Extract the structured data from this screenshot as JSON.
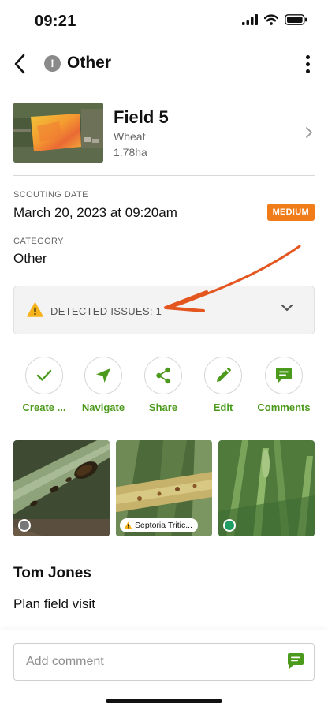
{
  "status_bar": {
    "time": "09:21"
  },
  "header": {
    "badge": "!",
    "title": "Other"
  },
  "field": {
    "name": "Field 5",
    "crop": "Wheat",
    "area": "1.78ha"
  },
  "scouting": {
    "date_label": "SCOUTING DATE",
    "date_value": "March 20, 2023 at 09:20am",
    "severity": "MEDIUM"
  },
  "category": {
    "label": "CATEGORY",
    "value": "Other"
  },
  "issues": {
    "label": "DETECTED ISSUES: 1"
  },
  "actions": [
    {
      "label": "Create ...",
      "icon": "check-icon"
    },
    {
      "label": "Navigate",
      "icon": "navigate-arrow-icon"
    },
    {
      "label": "Share",
      "icon": "share-icon"
    },
    {
      "label": "Edit",
      "icon": "pencil-icon"
    },
    {
      "label": "Comments",
      "icon": "comment-icon"
    }
  ],
  "photos": [
    {
      "status_color": "#777777"
    },
    {
      "tag": "Septoria Tritic..."
    },
    {
      "status_color": "#1e9e62"
    }
  ],
  "note": {
    "author": "Tom Jones",
    "text": "Plan field visit"
  },
  "comment": {
    "placeholder": "Add comment"
  },
  "colors": {
    "accent_green": "#4c9a1b",
    "severity_orange": "#f07d1a",
    "annotation_arrow": "#e4561f"
  }
}
